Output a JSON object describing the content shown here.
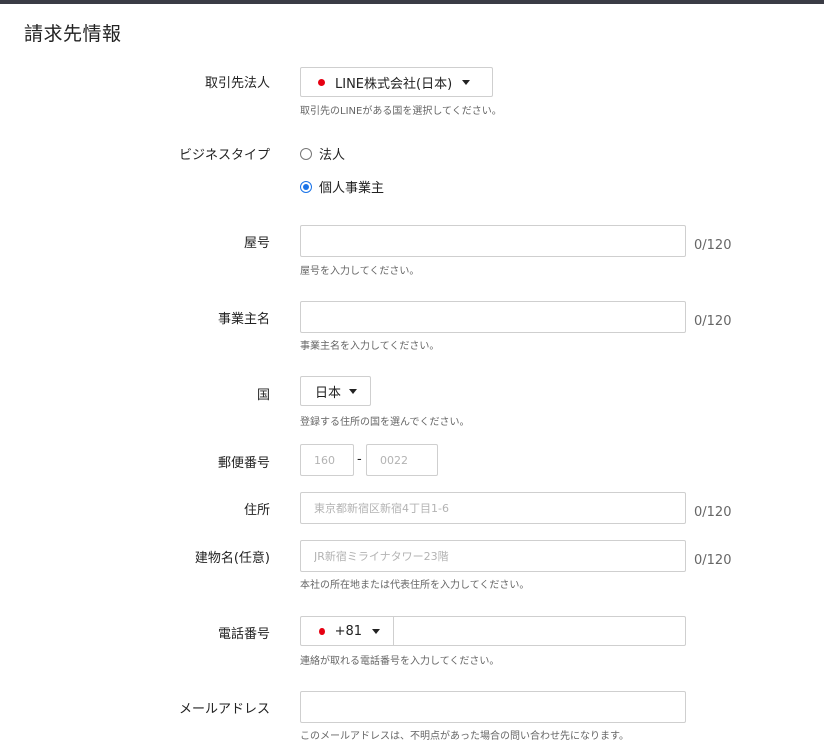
{
  "page": {
    "title": "請求先情報"
  },
  "fields": {
    "corporation": {
      "label": "取引先法人",
      "value": "LINE株式会社(日本)",
      "helper": "取引先のLINEがある国を選択してください。"
    },
    "business_type": {
      "label": "ビジネスタイプ",
      "options": [
        "法人",
        "個人事業主"
      ],
      "selected": "個人事業主"
    },
    "trade_name": {
      "label": "屋号",
      "value": "",
      "counter": "0/120",
      "helper": "屋号を入力してください。"
    },
    "owner_name": {
      "label": "事業主名",
      "value": "",
      "counter": "0/120",
      "helper": "事業主名を入力してください。"
    },
    "country": {
      "label": "国",
      "value": "日本",
      "helper": "登録する住所の国を選んでください。"
    },
    "postal_code": {
      "label": "郵便番号",
      "placeholder_first": "160",
      "separator": "-",
      "placeholder_second": "0022"
    },
    "address": {
      "label": "住所",
      "placeholder": "東京都新宿区新宿4丁目1-6",
      "counter": "0/120"
    },
    "building": {
      "label": "建物名(任意)",
      "placeholder": "JR新宿ミライナタワー23階",
      "counter": "0/120",
      "helper": "本社の所在地または代表住所を入力してください。"
    },
    "phone": {
      "label": "電話番号",
      "country_code": "+81",
      "value": "",
      "helper": "連絡が取れる電話番号を入力してください。"
    },
    "email": {
      "label": "メールアドレス",
      "value": "",
      "helper": "このメールアドレスは、不明点があった場合の問い合わせ先になります。"
    }
  },
  "icons": {
    "flag": "red-circle-flag-icon",
    "dropdown": "caret-down-icon"
  },
  "colors": {
    "accent": "#1a73e8",
    "flag_red": "#e60012",
    "topbar": "#3a3c45",
    "border": "#cfcfcf",
    "helper_text": "#666666",
    "placeholder": "#b3b3b3"
  }
}
